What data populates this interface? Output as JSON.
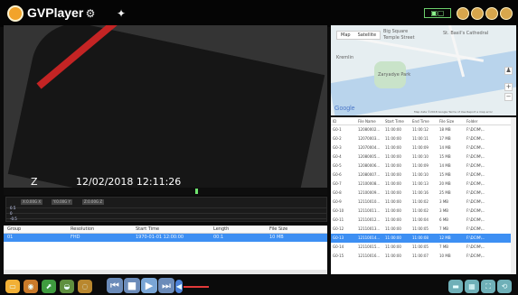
{
  "app": {
    "title": "GVPlayer"
  },
  "video": {
    "timestamp": "12/02/2018 12:11:26",
    "indicator": "Z"
  },
  "chart_strip": {
    "tags": [
      "X:0.00G X",
      "Y:0.00G Y",
      "Z:0.00G Z"
    ],
    "axis_labels": [
      "0.5",
      "0",
      "-0.5"
    ]
  },
  "group_table": {
    "headers": [
      "Group",
      "Resolution",
      "Start Time",
      "Length",
      "File Size"
    ],
    "row": [
      "01",
      "FHD",
      "1970-01-01 12:00:00",
      "00:1",
      "10 MB"
    ]
  },
  "map": {
    "tabs": [
      "Map",
      "Satellite"
    ],
    "labels": [
      "Big Square",
      "Temple Street",
      "St. Basil's Cathedral",
      "Zaryadye Park",
      "Kremlin"
    ],
    "attribution": "Map data ©2018 Google  Terms of Use  Report a map error"
  },
  "files": {
    "headers": [
      "ID",
      "File Name",
      "Start Time",
      "End Time",
      "File Size",
      "Folder"
    ],
    "rows": [
      [
        "G0-1",
        "12080002...",
        "11:00:00",
        "11:00:12",
        "18 MB",
        "F:\\DCIM\\..."
      ],
      [
        "G0-2",
        "12070003...",
        "11:00:00",
        "11:00:11",
        "17 MB",
        "F:\\DCIM\\..."
      ],
      [
        "G0-3",
        "12070004...",
        "11:00:00",
        "11:00:09",
        "14 MB",
        "F:\\DCIM\\..."
      ],
      [
        "G0-4",
        "12080005...",
        "11:00:00",
        "11:00:10",
        "15 MB",
        "F:\\DCIM\\..."
      ],
      [
        "G0-5",
        "12080006...",
        "11:00:00",
        "11:00:09",
        "14 MB",
        "F:\\DCIM\\..."
      ],
      [
        "G0-6",
        "12080007...",
        "11:00:00",
        "11:00:10",
        "15 MB",
        "F:\\DCIM\\..."
      ],
      [
        "G0-7",
        "12100008...",
        "11:00:00",
        "11:00:13",
        "20 MB",
        "F:\\DCIM\\..."
      ],
      [
        "G0-8",
        "12100009...",
        "11:00:00",
        "11:00:16",
        "25 MB",
        "F:\\DCIM\\..."
      ],
      [
        "G0-9",
        "12110010...",
        "11:00:00",
        "11:00:02",
        "3 MB",
        "F:\\DCIM\\..."
      ],
      [
        "G0-10",
        "12110011...",
        "11:00:00",
        "11:00:02",
        "3 MB",
        "F:\\DCIM\\..."
      ],
      [
        "G0-11",
        "12110012...",
        "11:00:00",
        "11:00:04",
        "6 MB",
        "F:\\DCIM\\..."
      ],
      [
        "G0-12",
        "12110013...",
        "11:00:00",
        "11:00:05",
        "7 MB",
        "F:\\DCIM\\..."
      ],
      [
        "G0-13",
        "12110014...",
        "11:00:00",
        "11:00:08",
        "12 MB",
        "F:\\DCIM\\..."
      ],
      [
        "G0-14",
        "12110015...",
        "11:00:00",
        "11:00:05",
        "7 MB",
        "F:\\DCIM\\..."
      ],
      [
        "G0-15",
        "12110016...",
        "11:00:00",
        "11:00:07",
        "10 MB",
        "F:\\DCIM\\..."
      ]
    ],
    "selected_index": 12
  }
}
